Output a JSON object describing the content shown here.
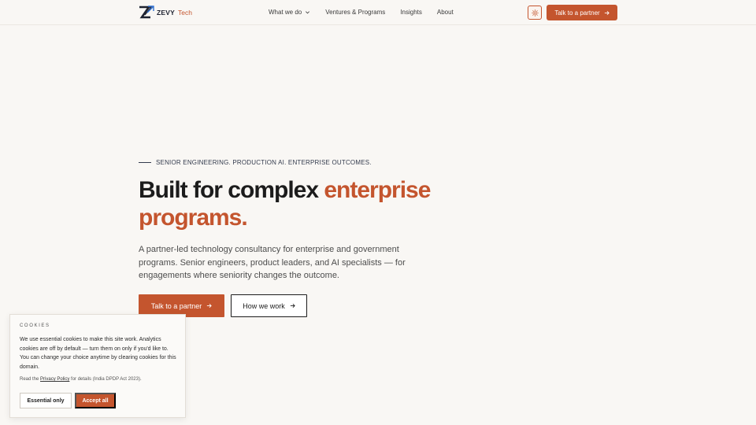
{
  "brand": {
    "name": "ZEVY",
    "suffix": "Tech",
    "accent_color": "#c4552e",
    "dark_color": "#1e2331"
  },
  "nav": {
    "items": [
      {
        "label": "What we do",
        "has_dropdown": true
      },
      {
        "label": "Ventures & Programs",
        "has_dropdown": false
      },
      {
        "label": "Insights",
        "has_dropdown": false
      },
      {
        "label": "About",
        "has_dropdown": false
      }
    ],
    "theme_toggle_icon": "sun-icon",
    "cta_label": "Talk to a partner"
  },
  "hero": {
    "eyebrow": "SENIOR ENGINEERING. PRODUCTION AI. ENTERPRISE OUTCOMES.",
    "headline_plain": "Built for complex ",
    "headline_accent": "enterprise programs.",
    "lead": "A partner-led technology consultancy for enterprise and government programs. Senior engineers, product leaders, and AI specialists — for engagements where seniority changes the outcome.",
    "primary_cta": "Talk to a partner",
    "secondary_cta": "How we work"
  },
  "cookie": {
    "title": "COOKIES",
    "body": "We use essential cookies to make this site work. Analytics cookies are off by default — turn them on only if you'd like to. You can change your choice anytime by clearing cookies for this domain.",
    "note_prefix": "Read the ",
    "note_link": "Privacy Policy",
    "note_suffix": " for details (India DPDP Act 2023).",
    "essential_label": "Essential only",
    "accept_label": "Accept all"
  }
}
